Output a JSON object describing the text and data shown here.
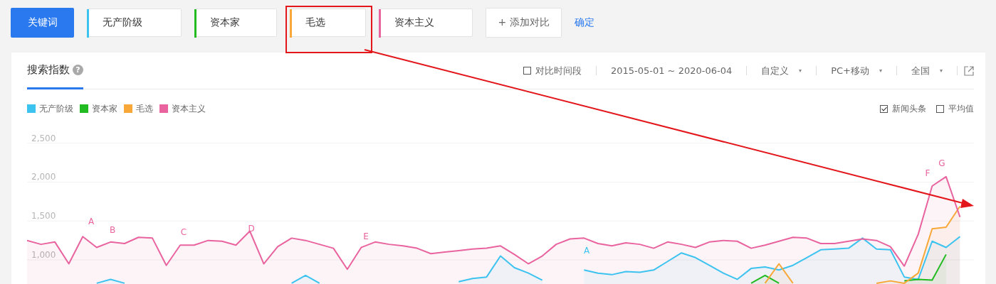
{
  "keyword_bar": {
    "mode_button": "关键词",
    "keywords": [
      {
        "label": "无产阶级",
        "color": "#3cc3ef"
      },
      {
        "label": "资本家",
        "color": "#22bb22"
      },
      {
        "label": "毛选",
        "color": "#f7a838"
      },
      {
        "label": "资本主义",
        "color": "#e9649f"
      }
    ],
    "add_button": "+ 添加对比",
    "confirm_link": "确定"
  },
  "panel": {
    "tabs": [
      {
        "label": "搜索指数",
        "selected": true
      }
    ],
    "help_icon": "?",
    "compare_period": {
      "label": "对比时间段",
      "checked": false
    },
    "date_range": "2015-05-01 ~ 2020-06-04",
    "dropdowns": [
      "自定义",
      "PC+移动",
      "全国"
    ],
    "options": [
      {
        "label": "新闻头条",
        "checked": true
      },
      {
        "label": "平均值",
        "checked": false
      }
    ],
    "chart_data": {
      "type": "area",
      "ylim": [
        690,
        2680
      ],
      "grid": true,
      "yticks": [
        {
          "value": 2500,
          "label": "2,500"
        },
        {
          "value": 2000,
          "label": "2,000"
        },
        {
          "value": 1500,
          "label": "1,500"
        },
        {
          "value": 1000,
          "label": "1,000"
        }
      ],
      "series": [
        {
          "name": "无产阶级",
          "color": "#3cc3ef",
          "values": [
            null,
            null,
            null,
            null,
            null,
            700,
            750,
            700,
            null,
            null,
            null,
            null,
            null,
            null,
            null,
            null,
            null,
            null,
            null,
            700,
            800,
            700,
            null,
            null,
            null,
            null,
            null,
            null,
            null,
            null,
            null,
            720,
            760,
            780,
            1050,
            900,
            830,
            740,
            null,
            null,
            870,
            830,
            810,
            850,
            840,
            870,
            980,
            1090,
            1030,
            930,
            830,
            750,
            890,
            910,
            870,
            930,
            1030,
            1130,
            1140,
            1150,
            1280,
            1140,
            1130,
            780,
            750,
            1240,
            1160,
            1300
          ]
        },
        {
          "name": "资本家",
          "color": "#22bb22",
          "values": [
            null,
            null,
            null,
            null,
            null,
            null,
            null,
            null,
            null,
            null,
            null,
            null,
            null,
            null,
            null,
            null,
            null,
            null,
            null,
            null,
            null,
            null,
            null,
            null,
            null,
            null,
            null,
            null,
            null,
            null,
            null,
            null,
            null,
            null,
            null,
            null,
            null,
            null,
            null,
            null,
            null,
            null,
            null,
            null,
            null,
            null,
            null,
            null,
            null,
            null,
            null,
            null,
            700,
            800,
            700,
            null,
            null,
            null,
            null,
            null,
            null,
            null,
            null,
            730,
            750,
            740,
            1070,
            null
          ]
        },
        {
          "name": "毛选",
          "color": "#f7a838",
          "values": [
            null,
            null,
            null,
            null,
            null,
            null,
            null,
            null,
            null,
            null,
            null,
            null,
            null,
            null,
            null,
            null,
            null,
            null,
            null,
            null,
            null,
            null,
            null,
            null,
            null,
            null,
            null,
            null,
            null,
            null,
            null,
            null,
            null,
            null,
            null,
            null,
            null,
            null,
            null,
            null,
            null,
            null,
            null,
            null,
            null,
            null,
            null,
            null,
            null,
            null,
            null,
            null,
            null,
            700,
            950,
            700,
            null,
            null,
            null,
            null,
            null,
            700,
            730,
            700,
            830,
            1400,
            1420,
            1690
          ]
        },
        {
          "name": "资本主义",
          "color": "#e9649f",
          "values": [
            1250,
            1200,
            1230,
            950,
            1300,
            1160,
            1230,
            1210,
            1290,
            1280,
            930,
            1190,
            1190,
            1250,
            1240,
            1190,
            1370,
            950,
            1170,
            1280,
            1250,
            1200,
            1150,
            880,
            1160,
            1230,
            1200,
            1180,
            1150,
            1080,
            1100,
            1120,
            1140,
            1150,
            1180,
            1070,
            950,
            1050,
            1200,
            1270,
            1280,
            1210,
            1180,
            1220,
            1200,
            1150,
            1230,
            1200,
            1160,
            1230,
            1250,
            1240,
            1150,
            1190,
            1240,
            1290,
            1280,
            1210,
            1210,
            1240,
            1270,
            1250,
            1170,
            920,
            1330,
            1950,
            2070,
            1550
          ]
        }
      ]
    },
    "markers": [
      {
        "label": "A",
        "color": "#e9649f"
      },
      {
        "label": "B",
        "color": "#e9649f"
      },
      {
        "label": "C",
        "color": "#e9649f"
      },
      {
        "label": "D",
        "color": "#e9649f"
      },
      {
        "label": "E",
        "color": "#e9649f"
      },
      {
        "label": "F",
        "color": "#e9649f"
      },
      {
        "label": "G",
        "color": "#e9649f"
      },
      {
        "label": "A",
        "color": "#3cc3ef"
      }
    ]
  }
}
